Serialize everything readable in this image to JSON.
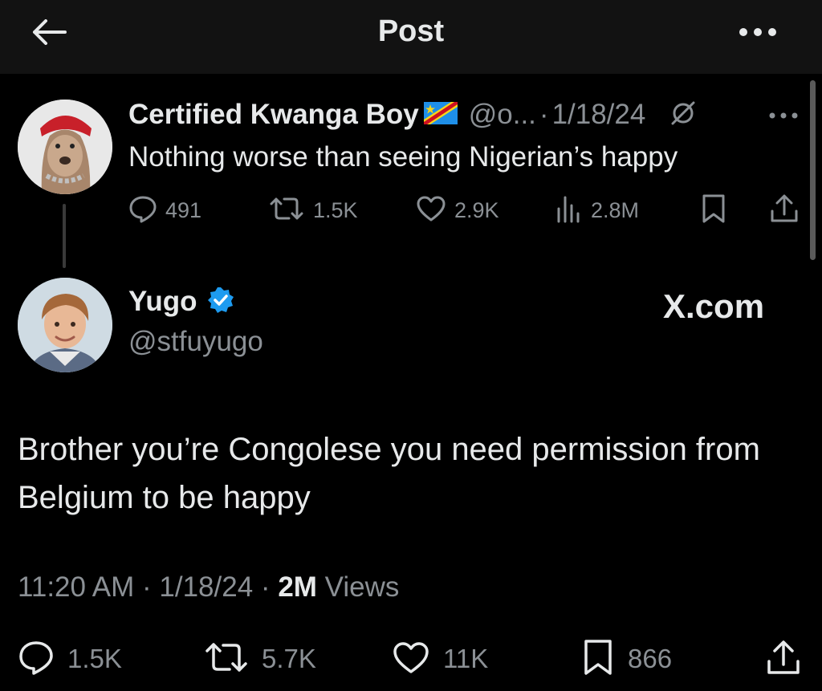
{
  "header": {
    "title": "Post"
  },
  "parent_tweet": {
    "name": "Certified Kwanga Boy",
    "flag": "DR Congo flag",
    "handle": "@o...",
    "separator": "·",
    "date": "1/18/24",
    "text": "Nothing worse than seeing Nigerian’s happy",
    "replies": "491",
    "reposts": "1.5K",
    "likes": "2.9K",
    "views": "2.8M"
  },
  "main_tweet": {
    "name": "Yugo",
    "handle": "@stfuyugo",
    "source_label": "X.com",
    "text": "Brother you’re Congolese you need permission from Belgium to be happy",
    "time": "11:20 AM",
    "date": "1/18/24",
    "separator": "·",
    "views_count": "2M",
    "views_label": "Views",
    "replies": "1.5K",
    "reposts": "5.7K",
    "likes": "11K",
    "bookmarks": "866"
  },
  "colors": {
    "background": "#000000",
    "header_background": "#121212",
    "text_primary": "#e7e9ea",
    "text_secondary": "#8b9095",
    "verified_blue": "#1d9bf0"
  }
}
